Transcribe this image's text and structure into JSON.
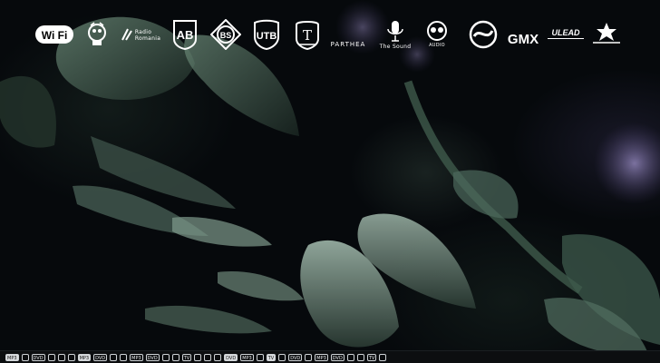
{
  "logos": [
    {
      "name": "wifi-logo",
      "text": "Wi Fi"
    },
    {
      "name": "soundtrack-logo",
      "text": ""
    },
    {
      "name": "radio-romania-logo",
      "text": "Radio\nRomania"
    },
    {
      "name": "ab-logo",
      "text": "AB"
    },
    {
      "name": "bs-logo",
      "text": "BS"
    },
    {
      "name": "utb-logo",
      "text": "UTB"
    },
    {
      "name": "t-logo",
      "text": "T"
    },
    {
      "name": "parthea-logo",
      "text": "PARTHEA"
    },
    {
      "name": "the-sound-logo",
      "text": "The Sound"
    },
    {
      "name": "audio-logo",
      "text": "AUDIO"
    },
    {
      "name": "s-swirl-logo",
      "text": ""
    },
    {
      "name": "gmx-logo",
      "text": "GMX"
    },
    {
      "name": "ulead-logo",
      "text": "ULEAD"
    },
    {
      "name": "star-badge-logo",
      "text": ""
    }
  ],
  "bottom_strip": [
    "MP3",
    "",
    "DVD",
    "",
    "",
    "",
    "MP3",
    "DVD",
    "",
    "",
    "MP3",
    "DVD",
    "",
    "",
    "TV",
    "",
    "",
    "",
    "DVD",
    "MP3",
    "",
    "TV",
    "",
    "DVD",
    "",
    "MP3",
    "DVD",
    "",
    "",
    "TV",
    ""
  ],
  "colors": {
    "logo": "#ffffff",
    "background": "#06090c",
    "leaf": "#5d7b6c",
    "flower": "#8a7bbf"
  }
}
